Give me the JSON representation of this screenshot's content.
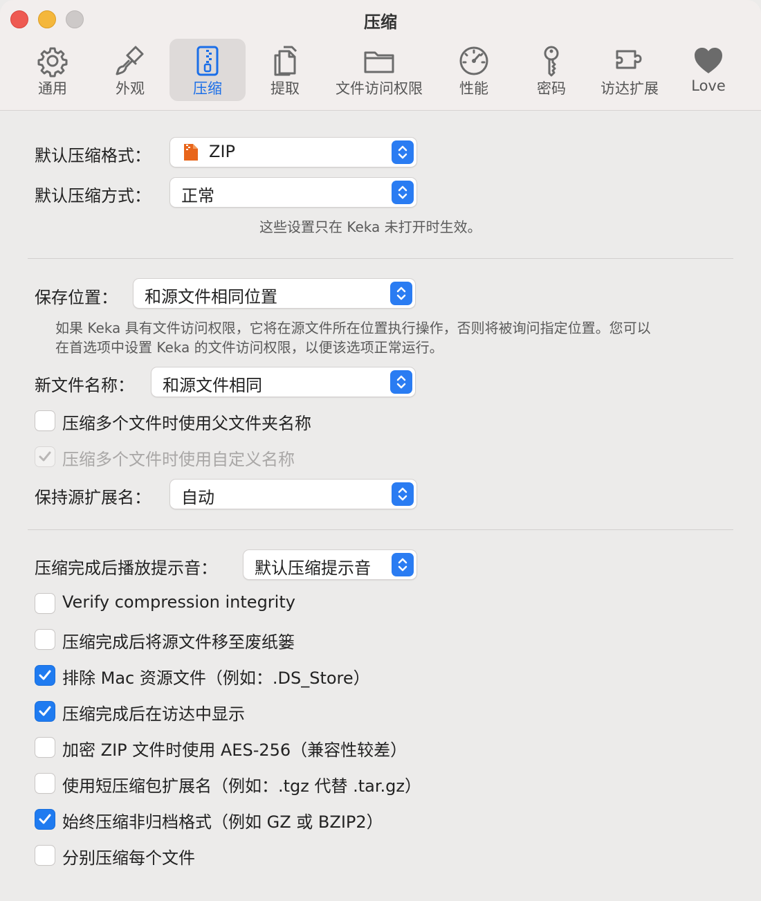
{
  "window": {
    "title": "压缩"
  },
  "tabs": [
    {
      "label": "通用",
      "icon": "gear-icon"
    },
    {
      "label": "外观",
      "icon": "paintbrush-icon"
    },
    {
      "label": "压缩",
      "icon": "zip-icon",
      "active": true
    },
    {
      "label": "提取",
      "icon": "documents-icon"
    },
    {
      "label": "文件访问权限",
      "icon": "folder-icon"
    },
    {
      "label": "性能",
      "icon": "gauge-icon"
    },
    {
      "label": "密码",
      "icon": "key-icon"
    },
    {
      "label": "访达扩展",
      "icon": "puzzle-icon"
    },
    {
      "label": "Love",
      "icon": "heart-icon"
    }
  ],
  "section1": {
    "format_label": "默认压缩格式：",
    "format_value": "ZIP",
    "method_label": "默认压缩方式：",
    "method_value": "正常",
    "note": "这些设置只在 Keka 未打开时生效。"
  },
  "section2": {
    "save_label": "保存位置：",
    "save_value": "和源文件相同位置",
    "save_note_line1": "如果 Keka 具有文件访问权限，它将在源文件所在位置执行操作，否则将被询问指定位置。您可以",
    "save_note_line2": "在首选项中设置 Keka 的文件访问权限，以便该选项正常运行。",
    "name_label": "新文件名称：",
    "name_value": "和源文件相同",
    "use_parent_folder": "压缩多个文件时使用父文件夹名称",
    "use_custom_name": "压缩多个文件时使用自定义名称",
    "ext_label": "保持源扩展名：",
    "ext_value": "自动"
  },
  "section3": {
    "sound_label": "压缩完成后播放提示音：",
    "sound_value": "默认压缩提示音",
    "options": [
      {
        "label": "Verify compression integrity",
        "checked": false
      },
      {
        "label": "压缩完成后将源文件移至废纸篓",
        "checked": false
      },
      {
        "label": "排除 Mac 资源文件（例如：.DS_Store）",
        "checked": true
      },
      {
        "label": "压缩完成后在访达中显示",
        "checked": true
      },
      {
        "label": "加密 ZIP 文件时使用 AES-256（兼容性较差）",
        "checked": false
      },
      {
        "label": "使用短压缩包扩展名（例如：.tgz 代替 .tar.gz）",
        "checked": false
      },
      {
        "label": "始终压缩非归档格式（例如 GZ 或 BZIP2）",
        "checked": true
      },
      {
        "label": "分别压缩每个文件",
        "checked": false
      }
    ]
  },
  "colors": {
    "accent": "#1f7bf0",
    "active_tab_text": "#1a6ee8"
  }
}
